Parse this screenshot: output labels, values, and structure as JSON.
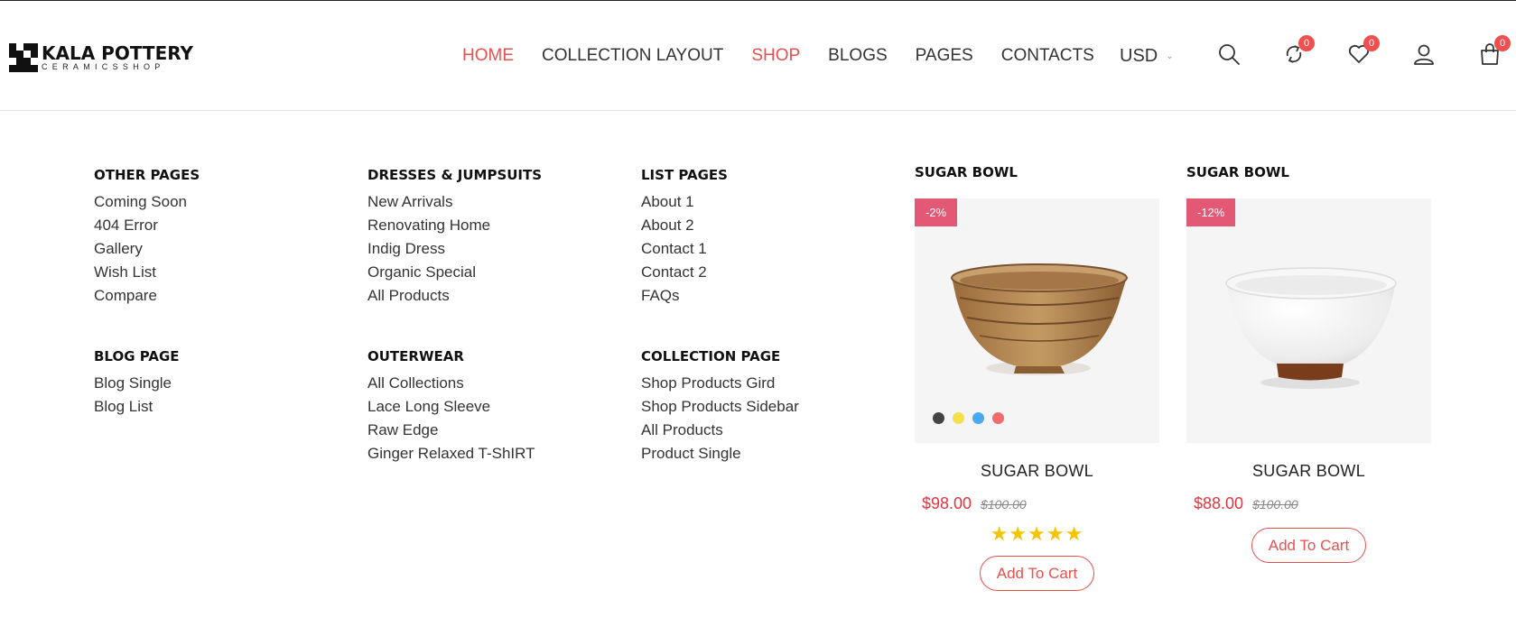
{
  "brand": {
    "name": "KALA POTTERY",
    "tagline": "CERAMICSSHOP"
  },
  "nav": [
    {
      "label": "HOME",
      "active": true
    },
    {
      "label": "COLLECTION LAYOUT",
      "active": false
    },
    {
      "label": "SHOP",
      "active": true
    },
    {
      "label": "BLOGS",
      "active": false
    },
    {
      "label": "PAGES",
      "active": false
    },
    {
      "label": "CONTACTS",
      "active": false
    }
  ],
  "currency": {
    "value": "USD"
  },
  "header_icons": {
    "compare_count": "0",
    "wishlist_count": "0",
    "cart_count": "0"
  },
  "menu": {
    "other_pages": {
      "heading": "OTHER PAGES",
      "links": [
        "Coming Soon",
        "404 Error",
        "Gallery",
        "Wish List",
        "Compare"
      ]
    },
    "blog_page": {
      "heading": "BLOG PAGE",
      "links": [
        "Blog Single",
        "Blog List"
      ]
    },
    "dresses": {
      "heading": "DRESSES & JUMPSUITS",
      "links": [
        "New Arrivals",
        "Renovating Home",
        "Indig Dress",
        "Organic Special",
        "All Products"
      ]
    },
    "outerwear": {
      "heading": "OUTERWEAR",
      "links": [
        "All Collections",
        "Lace Long Sleeve",
        "Raw Edge",
        "Ginger Relaxed T-ShIRT"
      ]
    },
    "list_pages": {
      "heading": "LIST PAGES",
      "links": [
        "About 1",
        "About 2",
        "Contact 1",
        "Contact 2",
        "FAQs"
      ]
    },
    "collection_page": {
      "heading": "COLLECTION PAGE",
      "links": [
        "Shop Products Gird",
        "Shop Products Sidebar",
        "All Products",
        "Product Single"
      ]
    }
  },
  "products": [
    {
      "heading": "SUGAR BOWL",
      "badge": "-2%",
      "name": "SUGAR BOWL",
      "price": "$98.00",
      "old_price": "$100.00",
      "rating": "★★★★★",
      "add_to_cart": "Add To Cart",
      "swatches": [
        "#444444",
        "#f5e04a",
        "#4aa8f0",
        "#f06b6b"
      ]
    },
    {
      "heading": "SUGAR BOWL",
      "badge": "-12%",
      "name": "SUGAR BOWL",
      "price": "$88.00",
      "old_price": "$100.00",
      "add_to_cart": "Add To Cart"
    }
  ],
  "colors": {
    "accent": "#e5514f",
    "badge": "#e35875",
    "price": "#e0363f",
    "star": "#f5c400"
  }
}
